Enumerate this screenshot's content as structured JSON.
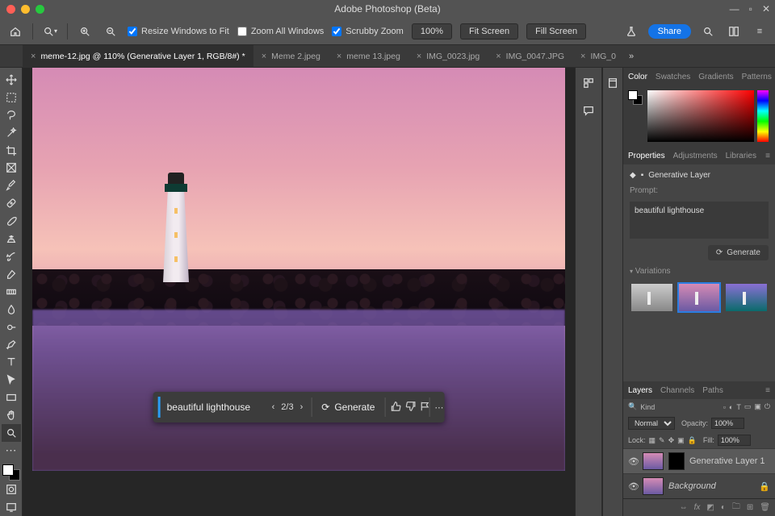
{
  "app_title": "Adobe Photoshop (Beta)",
  "options_bar": {
    "resize_windows": "Resize Windows to Fit",
    "zoom_all": "Zoom All Windows",
    "scrubby": "Scrubby Zoom",
    "zoom_value": "100%",
    "fit_screen": "Fit Screen",
    "fill_screen": "Fill Screen",
    "share": "Share"
  },
  "tabs": [
    {
      "label": "meme-12.jpg @ 110% (Generative Layer 1, RGB/8#) *",
      "active": true
    },
    {
      "label": "Meme 2.jpeg",
      "active": false
    },
    {
      "label": "meme 13.jpeg",
      "active": false
    },
    {
      "label": "IMG_0023.jpg",
      "active": false
    },
    {
      "label": "IMG_0047.JPG",
      "active": false
    },
    {
      "label": "IMG_0",
      "active": false
    }
  ],
  "gen_bar": {
    "prompt": "beautiful lighthouse",
    "counter": "2/3",
    "generate": "Generate"
  },
  "panels": {
    "color_tabs": [
      "Color",
      "Swatches",
      "Gradients",
      "Patterns"
    ],
    "props_tabs": [
      "Properties",
      "Adjustments",
      "Libraries"
    ],
    "gen_layer_label": "Generative Layer",
    "prompt_label": "Prompt:",
    "prompt_value": "beautiful lighthouse",
    "generate_btn": "Generate",
    "variations_label": "Variations",
    "layers_tabs": [
      "Layers",
      "Channels",
      "Paths"
    ],
    "kind_label": "Kind",
    "blend_mode": "Normal",
    "opacity_label": "Opacity:",
    "opacity_value": "100%",
    "lock_label": "Lock:",
    "fill_label": "Fill:",
    "fill_value": "100%",
    "layers": [
      {
        "name": "Generative Layer 1",
        "italic": false
      },
      {
        "name": "Background",
        "italic": true
      }
    ]
  }
}
